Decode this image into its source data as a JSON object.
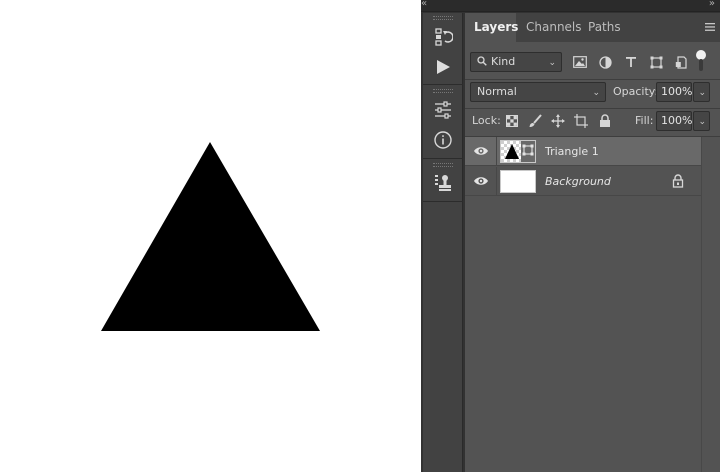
{
  "document": {
    "shape_fill": "#000000",
    "canvas_color": "#ffffff"
  },
  "tabs": [
    {
      "label": "Layers",
      "active": true
    },
    {
      "label": "Channels",
      "active": false
    },
    {
      "label": "Paths",
      "active": false
    }
  ],
  "filter": {
    "kind_label": "Kind",
    "icons": [
      "image-filter-icon",
      "adjustment-filter-icon",
      "type-filter-icon",
      "shape-filter-icon",
      "smart-object-filter-icon",
      "filter-toggle-icon"
    ]
  },
  "blend": {
    "mode": "Normal",
    "opacity_label": "Opacity:",
    "opacity_value": "100%"
  },
  "lock": {
    "label": "Lock:",
    "fill_label": "Fill:",
    "fill_value": "100%"
  },
  "layers": [
    {
      "name": "Triangle 1",
      "selected": true,
      "italic": false,
      "type": "shape"
    },
    {
      "name": "Background",
      "selected": false,
      "italic": true,
      "type": "background",
      "locked": true
    }
  ],
  "colors": {
    "panel_bg": "#535353",
    "selected_row": "#696969",
    "tab_bar": "#424242"
  }
}
